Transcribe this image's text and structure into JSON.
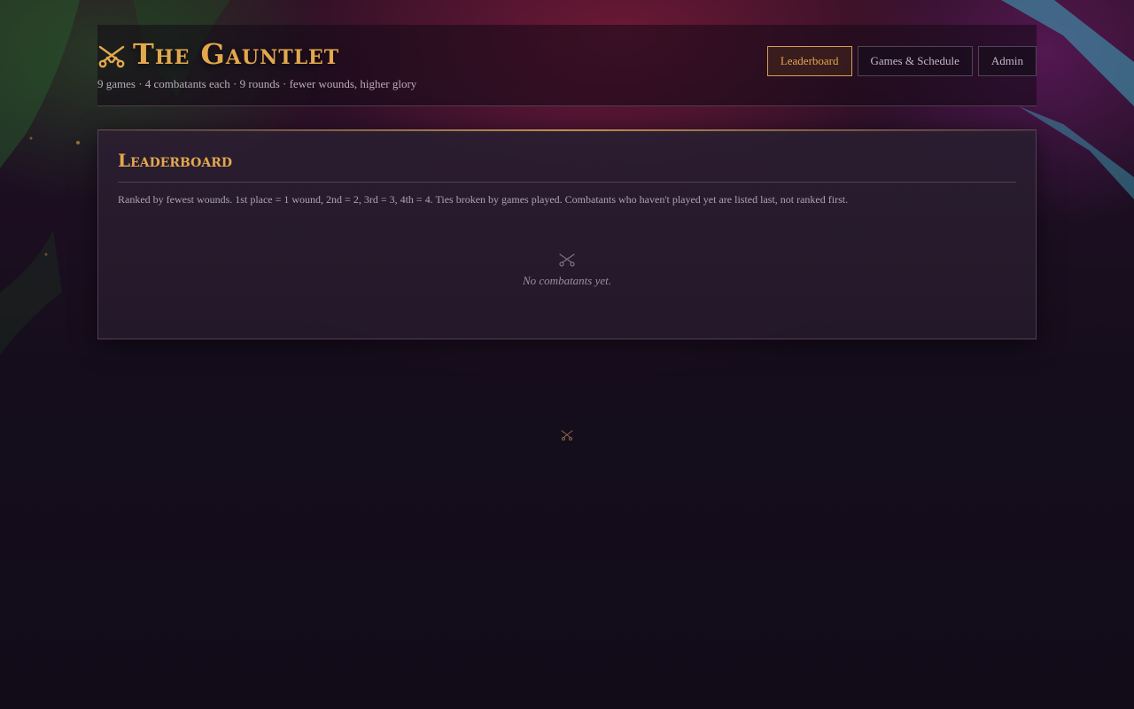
{
  "app": {
    "title": "The Gauntlet",
    "subtitle": "9 games · 4 combatants each · 9 rounds · fewer wounds, higher glory",
    "accent_color": "#e3a84e"
  },
  "nav": {
    "items": [
      {
        "label": "Leaderboard",
        "active": true
      },
      {
        "label": "Games & Schedule",
        "active": false
      },
      {
        "label": "Admin",
        "active": false
      }
    ]
  },
  "leaderboard": {
    "title": "Leaderboard",
    "description": "Ranked by fewest wounds. 1st place = 1 wound, 2nd = 2, 3rd = 3, 4th = 4. Ties broken by games played. Combatants who haven't played yet are listed last, not ranked first.",
    "empty_icon": "crossed-swords-icon",
    "empty_text": "No combatants yet."
  },
  "footer": {
    "icon": "crossed-swords-icon"
  }
}
